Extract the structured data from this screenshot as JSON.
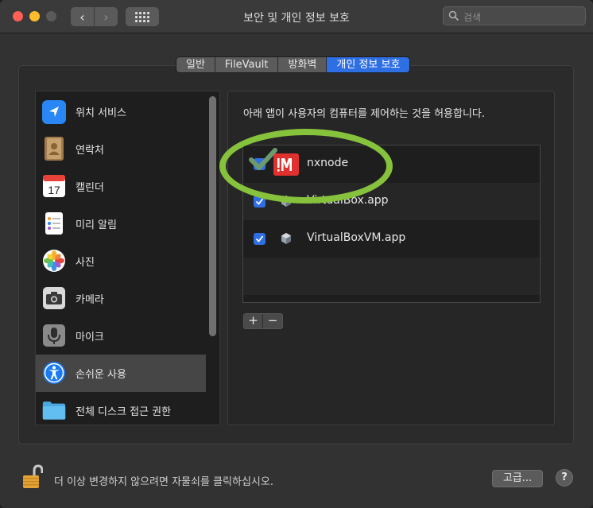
{
  "window": {
    "title": "보안 및 개인 정보 보호"
  },
  "toolbar": {
    "back_glyph": "‹",
    "forward_glyph": "›",
    "search_placeholder": "검색"
  },
  "tabs": [
    {
      "label": "일반",
      "active": false
    },
    {
      "label": "FileVault",
      "active": false
    },
    {
      "label": "방화벽",
      "active": false
    },
    {
      "label": "개인 정보 보호",
      "active": true
    }
  ],
  "sidebar": {
    "items": [
      {
        "label": "위치 서비스",
        "icon": "location-arrow-icon",
        "selected": false
      },
      {
        "label": "연락처",
        "icon": "contacts-book-icon",
        "selected": false
      },
      {
        "label": "캘린더",
        "icon": "calendar-icon",
        "selected": false,
        "icon_text": "17"
      },
      {
        "label": "미리 알림",
        "icon": "reminders-icon",
        "selected": false
      },
      {
        "label": "사진",
        "icon": "photos-icon",
        "selected": false
      },
      {
        "label": "카메라",
        "icon": "camera-icon",
        "selected": false
      },
      {
        "label": "마이크",
        "icon": "microphone-icon",
        "selected": false
      },
      {
        "label": "손쉬운 사용",
        "icon": "accessibility-icon",
        "selected": true
      },
      {
        "label": "전체 디스크 접근 권한",
        "icon": "folder-icon",
        "selected": false
      }
    ]
  },
  "main": {
    "description": "아래 앱이 사용자의 컴퓨터를 제어하는 것을 허용합니다.",
    "apps": [
      {
        "name": "nxnode",
        "checked": true,
        "icon": "nxnode-app-icon"
      },
      {
        "name": "VirtualBox.app",
        "checked": true,
        "icon": "virtualbox-cube-icon"
      },
      {
        "name": "VirtualBoxVM.app",
        "checked": true,
        "icon": "virtualbox-cube-icon"
      }
    ],
    "add_label": "+",
    "remove_label": "−"
  },
  "footer": {
    "lock_text": "더 이상 변경하지 않으려면 자물쇠를 클릭하십시오.",
    "advanced_label": "고급...",
    "help_label": "?"
  },
  "colors": {
    "accent": "#2f6fe4",
    "annotation": "#86c23b",
    "close": "#fe5f57",
    "minimize": "#febc2e"
  }
}
